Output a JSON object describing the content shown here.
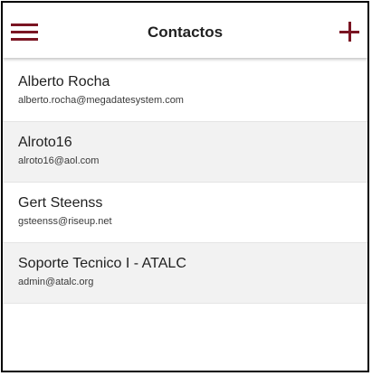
{
  "header": {
    "title": "Contactos",
    "menu_icon": "hamburger-menu-icon",
    "add_icon": "plus-icon",
    "accent_color": "#7a1422"
  },
  "contacts": [
    {
      "name": "Alberto Rocha",
      "email": "alberto.rocha@megadatesystem.com"
    },
    {
      "name": "Alroto16",
      "email": "alroto16@aol.com"
    },
    {
      "name": "Gert Steenss",
      "email": "gsteenss@riseup.net"
    },
    {
      "name": "Soporte Tecnico I - ATALC",
      "email": "admin@atalc.org"
    }
  ]
}
